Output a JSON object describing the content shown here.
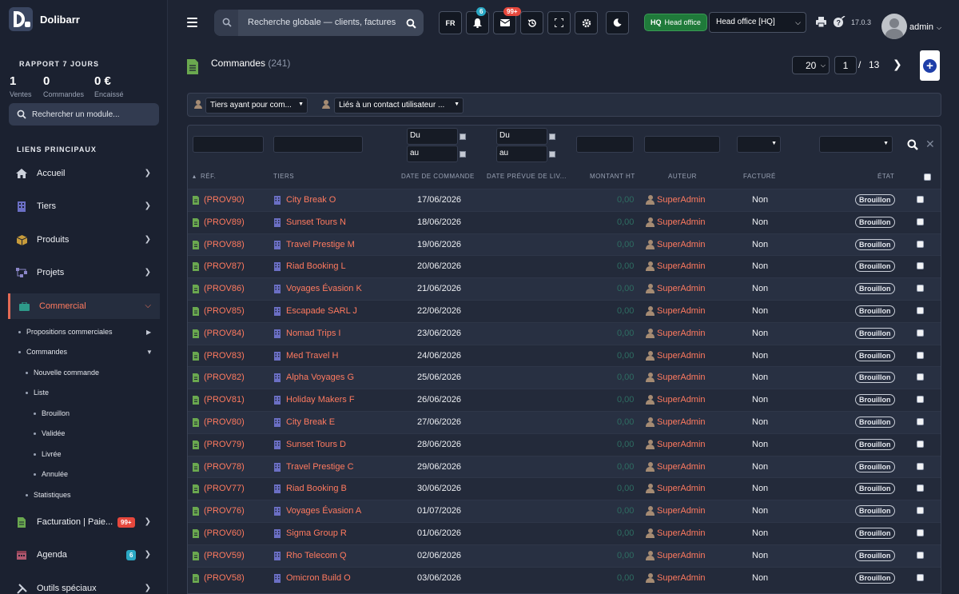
{
  "brand": {
    "name": "Dolibarr"
  },
  "report": {
    "title": "RAPPORT 7 JOURS",
    "stats": [
      {
        "value": "1",
        "label": "Ventes"
      },
      {
        "value": "0",
        "label": "Commandes"
      },
      {
        "value": "0 €",
        "label": "Encaissé"
      }
    ]
  },
  "module_search": {
    "placeholder": "Rechercher un module..."
  },
  "menu": {
    "section_title": "LIENS PRINCIPAUX",
    "items": [
      {
        "label": "Accueil"
      },
      {
        "label": "Tiers"
      },
      {
        "label": "Produits"
      },
      {
        "label": "Projets"
      },
      {
        "label": "Commercial"
      },
      {
        "label": "Facturation | Paie...",
        "badge": "99+"
      },
      {
        "label": "Agenda",
        "badge": "6"
      },
      {
        "label": "Outils spéciaux"
      }
    ],
    "sub": [
      "Propositions commerciales",
      "Commandes",
      "Nouvelle commande",
      "Liste",
      "Brouillon",
      "Validée",
      "Livrée",
      "Annulée",
      "Statistiques"
    ]
  },
  "topbar": {
    "search_placeholder": "Recherche globale — clients, factures",
    "lang": "FR",
    "notif_badge": "6",
    "mail_badge": "99+",
    "hq_short": "HQ",
    "hq_label": "Head office",
    "entity": "Head office [HQ]",
    "version": "17.0.3",
    "user": "admin"
  },
  "page": {
    "title": "Commandes",
    "count": "(241)",
    "limit": "20",
    "page": "1",
    "sep": "/",
    "total_pages": "13"
  },
  "filters": {
    "tiers": "Tiers ayant pour com...",
    "contact": "Liés à un contact utilisateur ..."
  },
  "search": {
    "du": "Du",
    "au": "au"
  },
  "columns": {
    "ref": "RÉF.",
    "tiers": "TIERS",
    "date": "DATE DE COMMANDE",
    "delivery": "DATE PRÉVUE DE LIV...",
    "amount": "MONTANT HT",
    "author": "AUTEUR",
    "billed": "FACTURÉ",
    "status": "ÉTAT"
  },
  "rows": [
    {
      "ref": "(PROV90)",
      "tiers": "City Break O",
      "date": "17/06/2026",
      "amount": "0,00",
      "author": "SuperAdmin",
      "billed": "Non",
      "status": "Brouillon"
    },
    {
      "ref": "(PROV89)",
      "tiers": "Sunset Tours N",
      "date": "18/06/2026",
      "amount": "0,00",
      "author": "SuperAdmin",
      "billed": "Non",
      "status": "Brouillon"
    },
    {
      "ref": "(PROV88)",
      "tiers": "Travel Prestige M",
      "date": "19/06/2026",
      "amount": "0,00",
      "author": "SuperAdmin",
      "billed": "Non",
      "status": "Brouillon"
    },
    {
      "ref": "(PROV87)",
      "tiers": "Riad Booking L",
      "date": "20/06/2026",
      "amount": "0,00",
      "author": "SuperAdmin",
      "billed": "Non",
      "status": "Brouillon"
    },
    {
      "ref": "(PROV86)",
      "tiers": "Voyages Évasion K",
      "date": "21/06/2026",
      "amount": "0,00",
      "author": "SuperAdmin",
      "billed": "Non",
      "status": "Brouillon"
    },
    {
      "ref": "(PROV85)",
      "tiers": "Escapade SARL J",
      "date": "22/06/2026",
      "amount": "0,00",
      "author": "SuperAdmin",
      "billed": "Non",
      "status": "Brouillon"
    },
    {
      "ref": "(PROV84)",
      "tiers": "Nomad Trips I",
      "date": "23/06/2026",
      "amount": "0,00",
      "author": "SuperAdmin",
      "billed": "Non",
      "status": "Brouillon"
    },
    {
      "ref": "(PROV83)",
      "tiers": "Med Travel H",
      "date": "24/06/2026",
      "amount": "0,00",
      "author": "SuperAdmin",
      "billed": "Non",
      "status": "Brouillon"
    },
    {
      "ref": "(PROV82)",
      "tiers": "Alpha Voyages G",
      "date": "25/06/2026",
      "amount": "0,00",
      "author": "SuperAdmin",
      "billed": "Non",
      "status": "Brouillon"
    },
    {
      "ref": "(PROV81)",
      "tiers": "Holiday Makers F",
      "date": "26/06/2026",
      "amount": "0,00",
      "author": "SuperAdmin",
      "billed": "Non",
      "status": "Brouillon"
    },
    {
      "ref": "(PROV80)",
      "tiers": "City Break E",
      "date": "27/06/2026",
      "amount": "0,00",
      "author": "SuperAdmin",
      "billed": "Non",
      "status": "Brouillon"
    },
    {
      "ref": "(PROV79)",
      "tiers": "Sunset Tours D",
      "date": "28/06/2026",
      "amount": "0,00",
      "author": "SuperAdmin",
      "billed": "Non",
      "status": "Brouillon"
    },
    {
      "ref": "(PROV78)",
      "tiers": "Travel Prestige C",
      "date": "29/06/2026",
      "amount": "0,00",
      "author": "SuperAdmin",
      "billed": "Non",
      "status": "Brouillon"
    },
    {
      "ref": "(PROV77)",
      "tiers": "Riad Booking B",
      "date": "30/06/2026",
      "amount": "0,00",
      "author": "SuperAdmin",
      "billed": "Non",
      "status": "Brouillon"
    },
    {
      "ref": "(PROV76)",
      "tiers": "Voyages Évasion A",
      "date": "01/07/2026",
      "amount": "0,00",
      "author": "SuperAdmin",
      "billed": "Non",
      "status": "Brouillon"
    },
    {
      "ref": "(PROV60)",
      "tiers": "Sigma Group R",
      "date": "01/06/2026",
      "amount": "0,00",
      "author": "SuperAdmin",
      "billed": "Non",
      "status": "Brouillon"
    },
    {
      "ref": "(PROV59)",
      "tiers": "Rho Telecom Q",
      "date": "02/06/2026",
      "amount": "0,00",
      "author": "SuperAdmin",
      "billed": "Non",
      "status": "Brouillon"
    },
    {
      "ref": "(PROV58)",
      "tiers": "Omicron Build O",
      "date": "03/06/2026",
      "amount": "0,00",
      "author": "SuperAdmin",
      "billed": "Non",
      "status": "Brouillon"
    }
  ],
  "colors": {
    "accent": "#ff7a5f",
    "green": "#1f7a3a",
    "badge_red": "#e6483d",
    "badge_teal": "#2aa8c4"
  }
}
